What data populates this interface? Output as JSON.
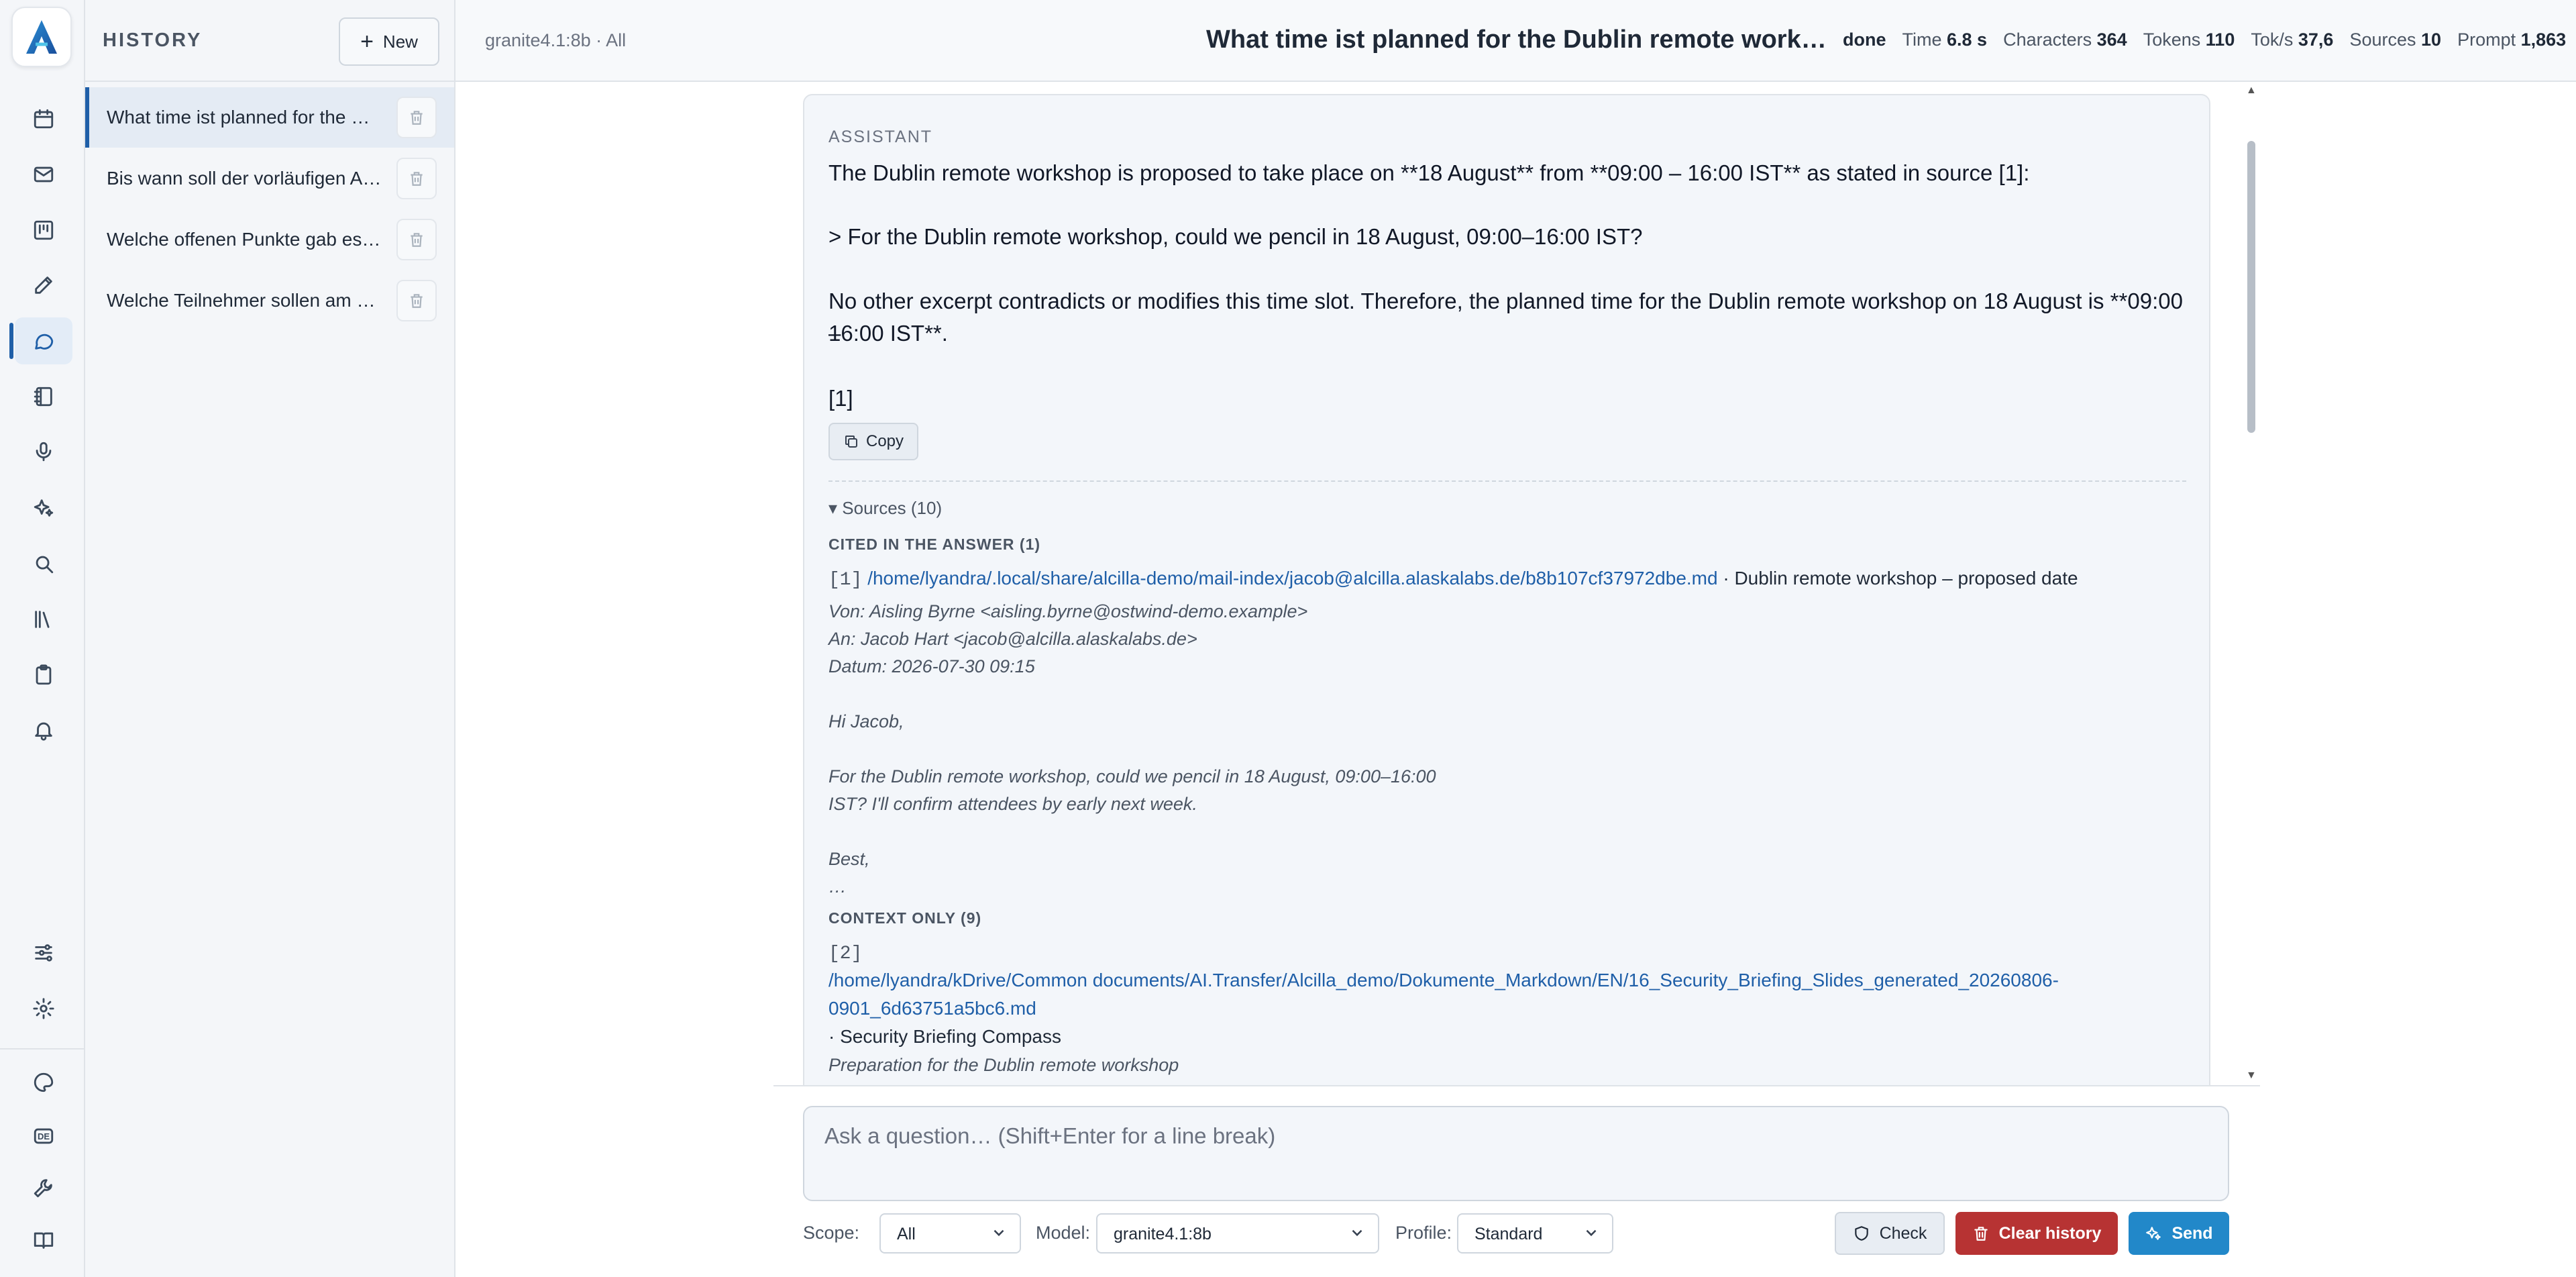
{
  "app": {
    "logo_letter": "A"
  },
  "rail": {
    "top_icons": [
      "calendar-icon",
      "mail-icon",
      "kanban-icon",
      "edit-icon",
      "chat-icon",
      "notebook-icon",
      "microphone-icon",
      "sparkles-icon",
      "search-icon",
      "library-icon",
      "clipboard-icon",
      "bell-icon"
    ],
    "active": "chat-icon",
    "bottom_icons": [
      "sliders-icon",
      "settings-icon",
      "palette-icon",
      "language-de-icon",
      "wrench-icon",
      "book-icon"
    ],
    "language_badge": "DE"
  },
  "history": {
    "title": "HISTORY",
    "new_label": "New",
    "items": [
      {
        "label": "What time ist planned for the D…"
      },
      {
        "label": "Bis wann soll der vorläufigen Ab…"
      },
      {
        "label": "Welche offenen Punkte gab es i…"
      },
      {
        "label": "Welche Teilnehmer sollen am V…"
      }
    ]
  },
  "topbar": {
    "crumb": "granite4.1:8b · All",
    "title": "What time ist planned for the Dublin remote worksh…",
    "status": "done",
    "stats": [
      {
        "label": "Time",
        "value": "6.8 s"
      },
      {
        "label": "Characters",
        "value": "364"
      },
      {
        "label": "Tokens",
        "value": "110"
      },
      {
        "label": "Tok/s",
        "value": "37,6"
      },
      {
        "label": "Sources",
        "value": "10"
      },
      {
        "label": "Prompt",
        "value": "1,863"
      }
    ]
  },
  "answer": {
    "role": "ASSISTANT",
    "p1": "The Dublin remote workshop is proposed to take place on **18 August** from **09:00 – 16:00 IST** as stated in source [1]:",
    "p2": "> For the Dublin remote workshop, could we pencil in 18 August, 09:00–16:00 IST?",
    "p3a": "No other excerpt contradicts or modifies this time slot. Therefore, the planned time for the Dublin remote workshop on 18 August is **09:00 –",
    "p3b": "16:00 IST**.",
    "p4": "[1]",
    "copy_label": "Copy",
    "sources_toggle": "▾ Sources (10)",
    "cited_head": "CITED IN THE ANSWER (1)",
    "cited": {
      "num": "[1]",
      "path": "/home/lyandra/.local/share/alcilla-demo/mail-index/jacob@alcilla.alaskalabs.de/b8b107cf37972dbe.md",
      "title": " · Dublin remote workshop – proposed date",
      "excerpt": [
        "Von: Aisling Byrne <aisling.byrne@ostwind-demo.example>",
        "An: Jacob Hart <jacob@alcilla.alaskalabs.de>",
        "Datum: 2026-07-30 09:15",
        "",
        "Hi Jacob,",
        "",
        "For the Dublin remote workshop, could we pencil in 18 August, 09:00–16:00",
        "IST? I'll confirm attendees by early next week.",
        "",
        "Best,",
        "…"
      ]
    },
    "context_head": "CONTEXT ONLY (9)",
    "context": {
      "num": "[2]",
      "path1": "/home/lyandra/kDrive/Common documents/AI.Transfer/Alcilla_demo/Dokumente_Markdown/EN/16_Security_Briefing_Slides_generated_20260806-",
      "path2": "0901_6d63751a5bc6.md",
      "title": "· Security Briefing Compass",
      "excerpt": "Preparation for the Dublin remote workshop"
    }
  },
  "composer": {
    "placeholder": "Ask a question… (Shift+Enter for a line break)",
    "scope_label": "Scope:",
    "scope_value": "All",
    "model_label": "Model:",
    "model_value": "granite4.1:8b",
    "profile_label": "Profile:",
    "profile_value": "Standard",
    "check_label": "Check",
    "clear_label": "Clear history",
    "send_label": "Send"
  },
  "colors": {
    "accent": "#1f5fa8",
    "danger": "#b73333",
    "send": "#2288c9"
  }
}
